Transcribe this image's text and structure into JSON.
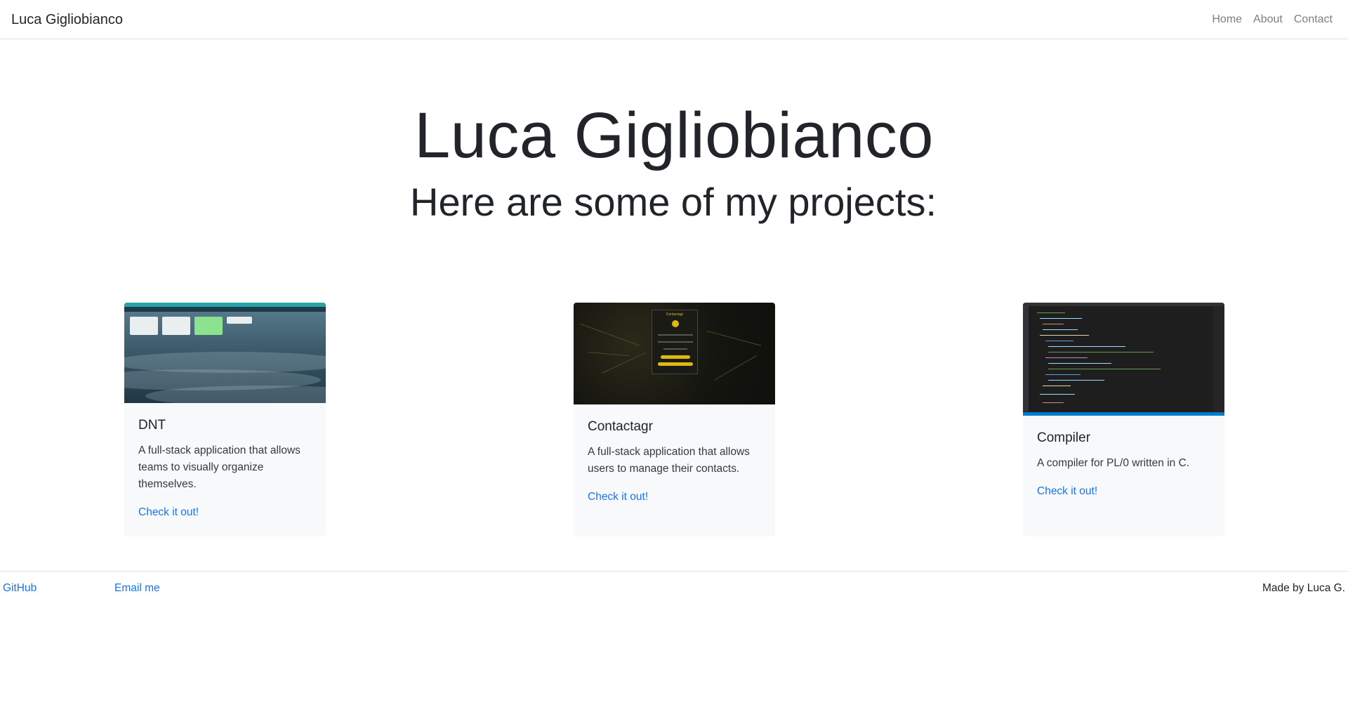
{
  "navbar": {
    "brand": "Luca Gigliobianco",
    "links": [
      "Home",
      "About",
      "Contact"
    ]
  },
  "hero": {
    "title": "Luca Gigliobianco",
    "subtitle": "Here are some of my projects:"
  },
  "projects": [
    {
      "title": "DNT",
      "description": "A full-stack application that allows teams to visually organize themselves.",
      "link_label": "Check it out!",
      "image": "dnt-screenshot"
    },
    {
      "title": "Contactagr",
      "description": "A full-stack application that allows users to manage their contacts.",
      "link_label": "Check it out!",
      "image": "contactagr-screenshot",
      "image_caption": "Contactagr"
    },
    {
      "title": "Compiler",
      "description": "A compiler for PL/0 written in C.",
      "link_label": "Check it out!",
      "image": "compiler-screenshot"
    }
  ],
  "footer": {
    "github_label": "GitHub",
    "email_label": "Email me",
    "credit": "Made by Luca G."
  },
  "colors": {
    "link": "#1a73e8",
    "card_bg": "#f8f9fa",
    "text": "#212529",
    "nav_link": "#7a7f85"
  }
}
